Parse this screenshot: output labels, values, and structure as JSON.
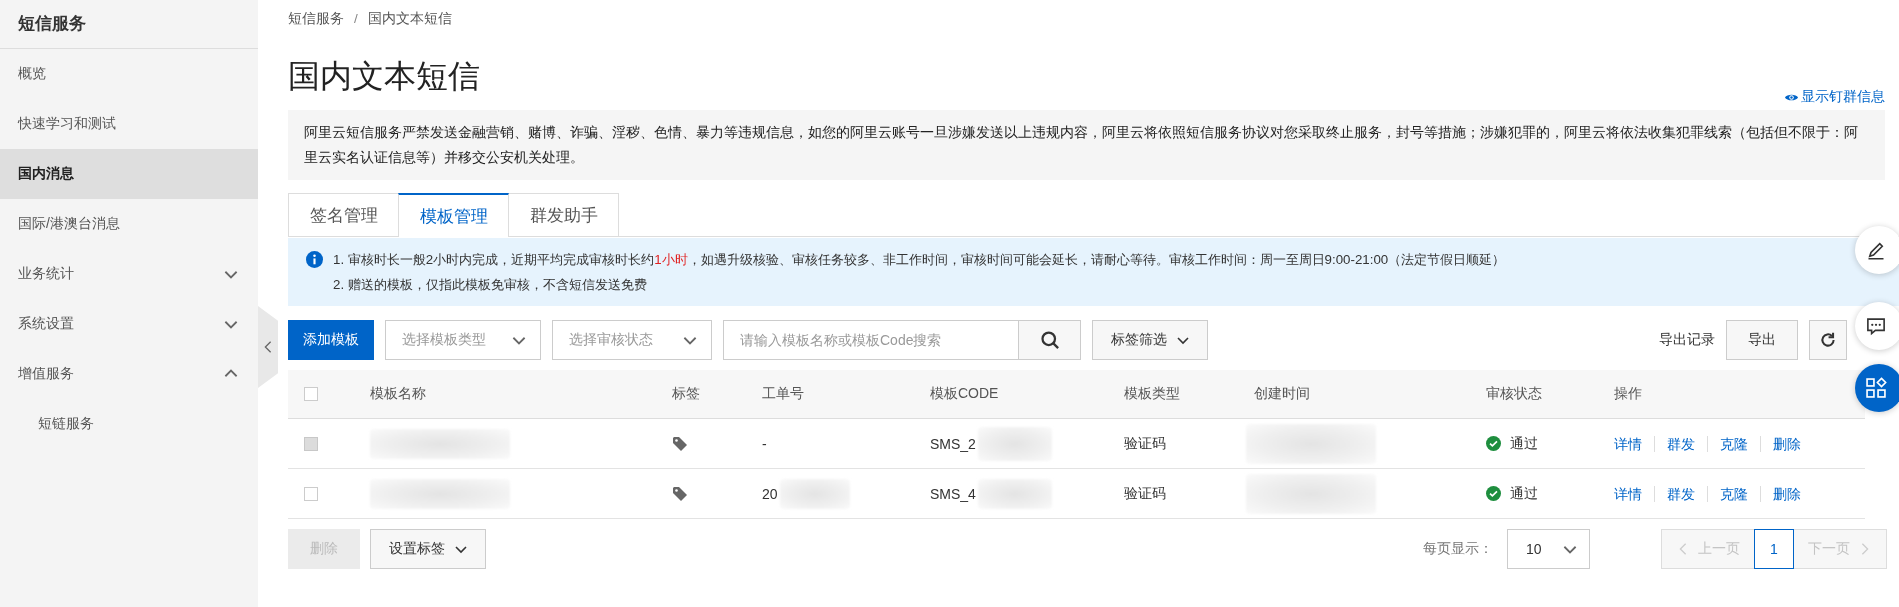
{
  "sidebar": {
    "title": "短信服务",
    "items": [
      {
        "label": "概览",
        "kind": "link",
        "selected": false
      },
      {
        "label": "快速学习和测试",
        "kind": "link",
        "selected": false
      },
      {
        "label": "国内消息",
        "kind": "link",
        "selected": true
      },
      {
        "label": "国际/港澳台消息",
        "kind": "link",
        "selected": false
      },
      {
        "label": "业务统计",
        "kind": "group",
        "expanded": false
      },
      {
        "label": "系统设置",
        "kind": "group",
        "expanded": false
      },
      {
        "label": "增值服务",
        "kind": "group",
        "expanded": true,
        "children": [
          {
            "label": "短链服务",
            "kind": "link",
            "selected": false
          }
        ]
      }
    ]
  },
  "breadcrumb": {
    "items": [
      "短信服务",
      "国内文本短信"
    ],
    "separator": "/"
  },
  "page_title": "国内文本短信",
  "dingtalk_link": "显示钉群信息",
  "warning": "阿里云短信服务严禁发送金融营销、赌博、诈骗、淫秽、色情、暴力等违规信息，如您的阿里云账号一旦涉嫌发送以上违规内容，阿里云将依照短信服务协议对您采取终止服务，封号等措施；涉嫌犯罪的，阿里云将依法收集犯罪线索（包括但不限于：阿里云实名认证信息等）并移交公安机关处理。",
  "tabs": [
    {
      "label": "签名管理",
      "selected": false
    },
    {
      "label": "模板管理",
      "selected": true
    },
    {
      "label": "群发助手",
      "selected": false
    }
  ],
  "notes": [
    {
      "text": "1. 审核时长一般2小时内完成，近期平均完成审核时长约",
      "highlight": "1小时",
      "rest": "，如遇升级核验、审核任务较多、非工作时间，审核时间可能会延长，请耐心等待。审核工作时间：周一至周日9:00-21:00（法定节假日顺延）"
    },
    {
      "text": "2. 赠送的模板，仅指此模板免审核，不含短信发送免费"
    }
  ],
  "toolbar": {
    "add_button": "添加模板",
    "type_select": {
      "placeholder": "选择模板类型"
    },
    "status_select": {
      "placeholder": "选择审核状态"
    },
    "search": {
      "placeholder": "请输入模板名称或模板Code搜索"
    },
    "tag_filter": "标签筛选",
    "export_record": "导出记录",
    "export_button": "导出"
  },
  "table": {
    "all_checked": false,
    "columns": [
      "模板名称",
      "标签",
      "工单号",
      "模板CODE",
      "模板类型",
      "创建时间",
      "审核状态",
      "操作"
    ],
    "rows": [
      {
        "checked": false,
        "disabled": true,
        "order_no": "-",
        "code": "SMS_2",
        "type": "验证码",
        "status": "通过",
        "actions": [
          "详情",
          "群发",
          "克隆",
          "删除"
        ]
      },
      {
        "checked": false,
        "disabled": false,
        "order_no": "20",
        "code": "SMS_4",
        "type": "验证码",
        "status": "通过",
        "actions": [
          "详情",
          "群发",
          "克隆",
          "删除"
        ]
      }
    ]
  },
  "footer": {
    "delete_button": {
      "label": "删除",
      "disabled": true
    },
    "set_tag_button": "设置标签",
    "page_size_label": "每页显示：",
    "page_size": "10",
    "prev": {
      "label": "上一页",
      "disabled": true
    },
    "pages": [
      {
        "label": "1",
        "selected": true
      }
    ],
    "next": {
      "label": "下一页",
      "disabled": true
    }
  }
}
